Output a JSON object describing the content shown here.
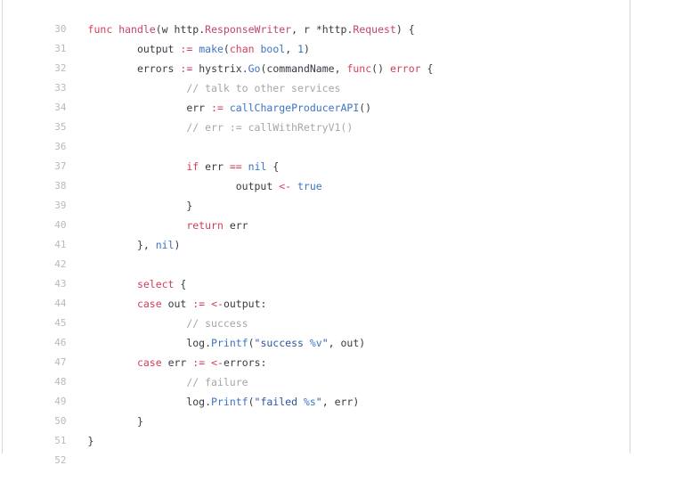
{
  "editor": {
    "language": "go",
    "first_line_number": 30,
    "last_line_number": 52,
    "line_height_px": 22,
    "colors": {
      "background": "#ffffff",
      "text": "#383a42",
      "line_number": "#b9b9be",
      "keyword": "#d63d5a",
      "function": "#3b74c4",
      "type": "#3b74c4",
      "operator": "#d63d5a",
      "comment": "#a6a6ab",
      "string": "#2f55a0",
      "format_verb": "#3b74c4",
      "border": "#d8d8dc"
    }
  },
  "lines": [
    {
      "num": "30",
      "text": "func handle(w http.ResponseWriter, r *http.Request) {"
    },
    {
      "num": "31",
      "text": "\toutput := make(chan bool, 1)"
    },
    {
      "num": "32",
      "text": "\terrors := hystrix.Go(commandName, func() error {"
    },
    {
      "num": "33",
      "text": "\t\t// talk to other services"
    },
    {
      "num": "34",
      "text": "\t\terr := callChargeProducerAPI()"
    },
    {
      "num": "35",
      "text": "\t\t// err := callWithRetryV1()"
    },
    {
      "num": "36",
      "text": ""
    },
    {
      "num": "37",
      "text": "\t\tif err == nil {"
    },
    {
      "num": "38",
      "text": "\t\t\toutput <- true"
    },
    {
      "num": "39",
      "text": "\t\t}"
    },
    {
      "num": "40",
      "text": "\t\treturn err"
    },
    {
      "num": "41",
      "text": "\t}, nil)"
    },
    {
      "num": "42",
      "text": ""
    },
    {
      "num": "43",
      "text": "\tselect {"
    },
    {
      "num": "44",
      "text": "\tcase out := <-output:"
    },
    {
      "num": "45",
      "text": "\t\t// success"
    },
    {
      "num": "46",
      "text": "\t\tlog.Printf(\"success %v\", out)"
    },
    {
      "num": "47",
      "text": "\tcase err := <-errors:"
    },
    {
      "num": "48",
      "text": "\t\t// failure"
    },
    {
      "num": "49",
      "text": "\t\tlog.Printf(\"failed %s\", err)"
    },
    {
      "num": "50",
      "text": "\t}"
    },
    {
      "num": "51",
      "text": "}"
    },
    {
      "num": "52",
      "text": ""
    }
  ],
  "line_numbers": [
    "30",
    "31",
    "32",
    "33",
    "34",
    "35",
    "36",
    "37",
    "38",
    "39",
    "40",
    "41",
    "42",
    "43",
    "44",
    "45",
    "46",
    "47",
    "48",
    "49",
    "50",
    "51",
    "52"
  ]
}
